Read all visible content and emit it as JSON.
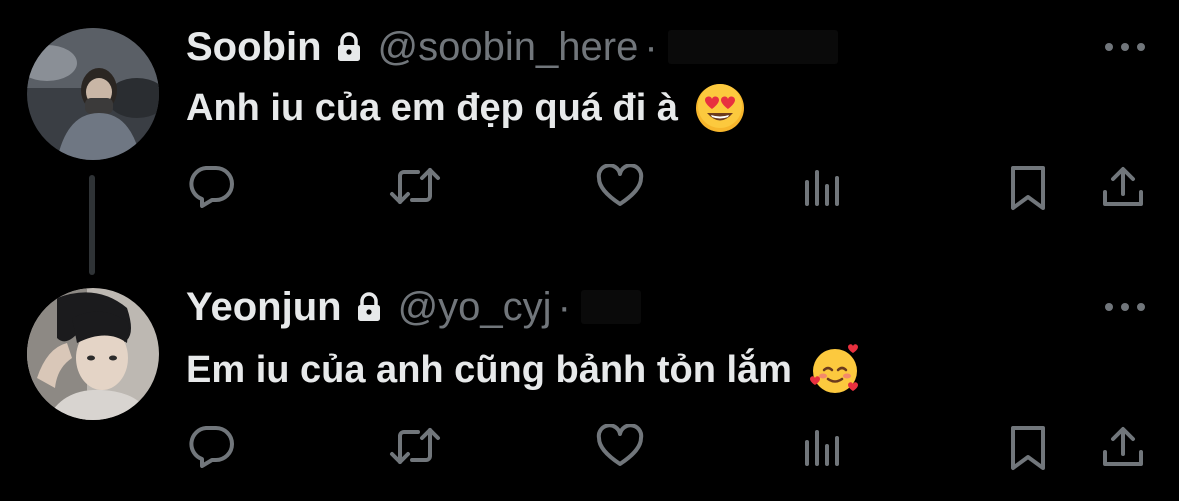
{
  "tweets": [
    {
      "name": "Soobin",
      "handle": "@soobin_here",
      "separator": "·",
      "text": "Anh iu của em đẹp quá đi à",
      "emoji": "smiling-face-with-heart-eyes",
      "icons": [
        "reply-icon",
        "retweet-icon",
        "like-icon",
        "views-icon",
        "bookmark-icon",
        "share-icon"
      ]
    },
    {
      "name": "Yeonjun",
      "handle": "@yo_cyj",
      "separator": "·",
      "text": "Em iu của anh cũng bảnh tỏn lắm",
      "emoji": "smiling-face-with-hearts",
      "icons": [
        "reply-icon",
        "retweet-icon",
        "like-icon",
        "views-icon",
        "bookmark-icon",
        "share-icon"
      ]
    }
  ],
  "colors": {
    "background": "#000000",
    "primary_text": "#e7e9ea",
    "secondary_text": "#71767b",
    "thread_line": "#2f3336",
    "icon": "#71767b"
  }
}
